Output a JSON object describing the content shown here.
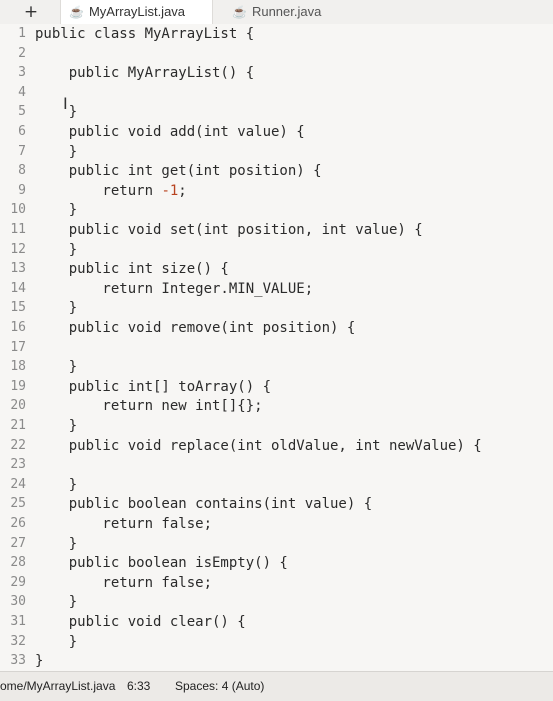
{
  "tabs": {
    "new_tab_symbol": "+",
    "active_label": "MyArrayList.java",
    "inactive_label": "Runner.java"
  },
  "editor": {
    "lines": [
      {
        "n": "1",
        "text": "public class MyArrayList {"
      },
      {
        "n": "2",
        "text": ""
      },
      {
        "n": "3",
        "text": "    public MyArrayList() {"
      },
      {
        "n": "4",
        "text": ""
      },
      {
        "n": "5",
        "text": "    }"
      },
      {
        "n": "6",
        "text": "    public void add(int value) {"
      },
      {
        "n": "7",
        "text": "    }"
      },
      {
        "n": "8",
        "text": "    public int get(int position) {"
      },
      {
        "n": "9",
        "text": "        return -1;"
      },
      {
        "n": "10",
        "text": "    }"
      },
      {
        "n": "11",
        "text": "    public void set(int position, int value) {"
      },
      {
        "n": "12",
        "text": "    }"
      },
      {
        "n": "13",
        "text": "    public int size() {"
      },
      {
        "n": "14",
        "text": "        return Integer.MIN_VALUE;"
      },
      {
        "n": "15",
        "text": "    }"
      },
      {
        "n": "16",
        "text": "    public void remove(int position) {"
      },
      {
        "n": "17",
        "text": ""
      },
      {
        "n": "18",
        "text": "    }"
      },
      {
        "n": "19",
        "text": "    public int[] toArray() {"
      },
      {
        "n": "20",
        "text": "        return new int[]{};"
      },
      {
        "n": "21",
        "text": "    }"
      },
      {
        "n": "22",
        "text": "    public void replace(int oldValue, int newValue) {"
      },
      {
        "n": "23",
        "text": ""
      },
      {
        "n": "24",
        "text": "    }"
      },
      {
        "n": "25",
        "text": "    public boolean contains(int value) {"
      },
      {
        "n": "26",
        "text": "        return false;"
      },
      {
        "n": "27",
        "text": "    }"
      },
      {
        "n": "28",
        "text": "    public boolean isEmpty() {"
      },
      {
        "n": "29",
        "text": "        return false;"
      },
      {
        "n": "30",
        "text": "    }"
      },
      {
        "n": "31",
        "text": "    public void clear() {"
      },
      {
        "n": "32",
        "text": "    }"
      },
      {
        "n": "33",
        "text": "}"
      }
    ]
  },
  "status": {
    "path": "ome/MyArrayList.java",
    "position": "6:33",
    "spaces": "Spaces: 4 (Auto)"
  },
  "colors": {
    "editor_bg": "#f7f6f4",
    "line_number": "#8a8a8a",
    "numeric_literal": "#b8431f",
    "java_icon": "#d27a1e"
  },
  "icons": {
    "tab_file_icon": "java-file-icon",
    "cursor": "text-cursor-icon"
  }
}
